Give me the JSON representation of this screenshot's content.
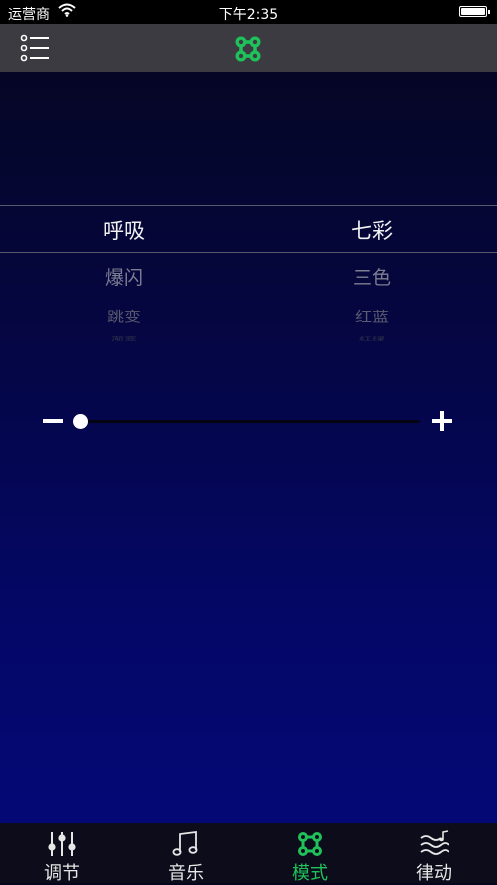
{
  "status_bar": {
    "carrier": "运营商",
    "time": "下午2:35"
  },
  "nav": {
    "menu_icon": "list-icon",
    "logo_icon": "command-icon",
    "logo_color": "#1fc25a"
  },
  "picker": {
    "columns": [
      {
        "selected": "呼吸",
        "next": "爆闪",
        "next2": "跳变",
        "next3": "渐变"
      },
      {
        "selected": "七彩",
        "next": "三色",
        "next2": "红蓝",
        "next3": "红绿"
      }
    ]
  },
  "slider": {
    "value": 0.0,
    "minus_icon": "minus-icon",
    "plus_icon": "plus-icon"
  },
  "tabs": [
    {
      "label": "调节",
      "icon": "sliders-icon",
      "active": false
    },
    {
      "label": "音乐",
      "icon": "music-note-icon",
      "active": false
    },
    {
      "label": "模式",
      "icon": "command-icon",
      "active": true
    },
    {
      "label": "律动",
      "icon": "wave-note-icon",
      "active": false
    }
  ],
  "colors": {
    "accent": "#1fc25a",
    "tab_text": "#e6e6e6"
  }
}
